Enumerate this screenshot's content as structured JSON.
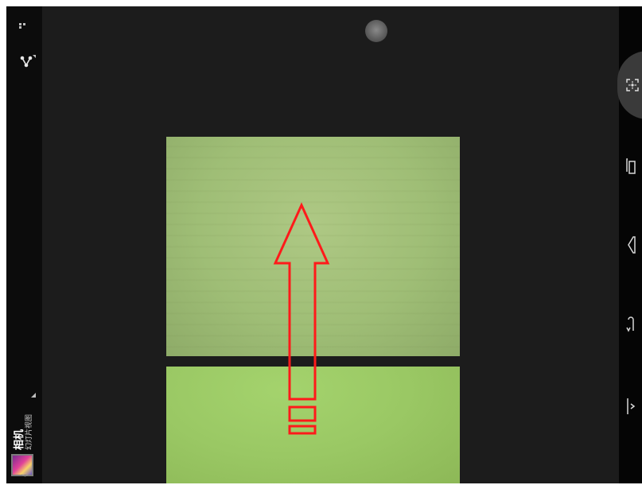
{
  "app": {
    "title": "相机",
    "subtitle": "幻灯片视图"
  },
  "icons": {
    "menu": "more-dots-icon",
    "share": "share-icon",
    "thumbnail": "app-thumbnail-icon",
    "chevron": "chevron-down-icon",
    "shutter": "shutter-knob-icon",
    "rail": [
      "capture-frame-icon",
      "copy-icon",
      "back-bracket-icon",
      "rotate-icon",
      "end-bar-icon"
    ]
  },
  "colors": {
    "overlay_arrow": "#ff1a1a",
    "background": "#1c1c1c",
    "rail_active": "#3a3a3a"
  }
}
